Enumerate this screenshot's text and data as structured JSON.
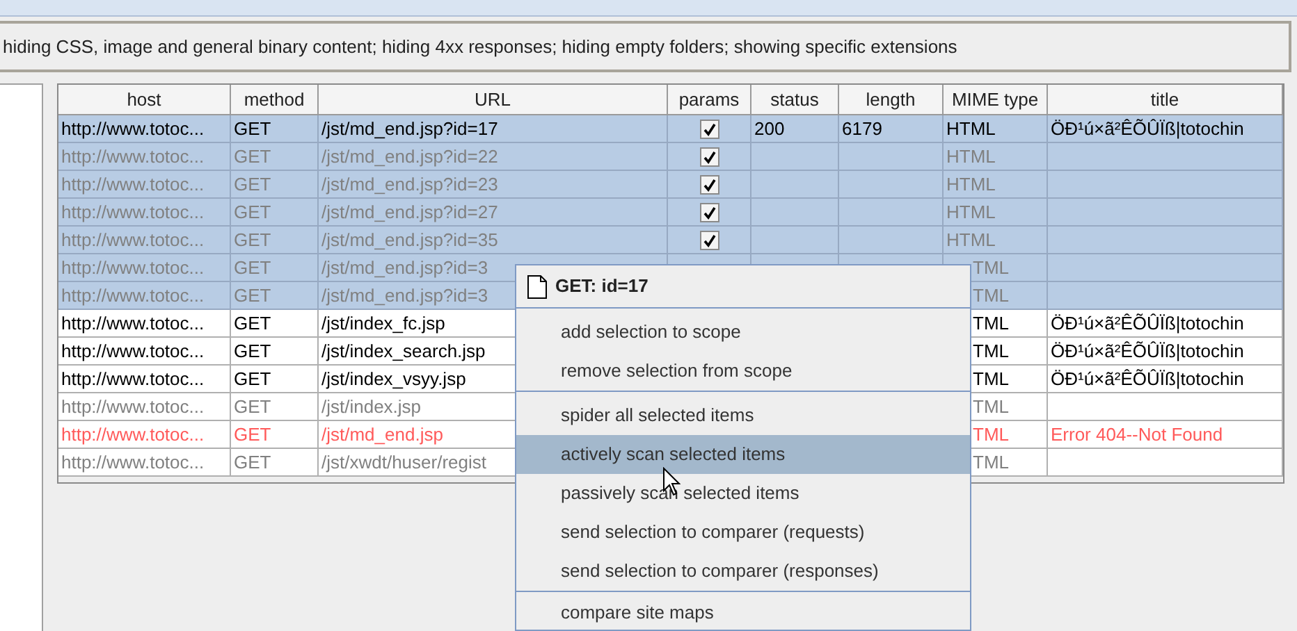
{
  "filter_bar": {
    "text": "hiding CSS, image and general binary content;  hiding 4xx responses;  hiding empty folders;  showing specific extensions"
  },
  "table": {
    "columns": [
      "host",
      "method",
      "URL",
      "params",
      "status",
      "length",
      "MIME type",
      "title"
    ],
    "rows": [
      {
        "host": "http://www.totoc...",
        "method": "GET",
        "url": "/jst/md_end.jsp?id=17",
        "params": {
          "checked": true
        },
        "status": "200",
        "length": "6179",
        "mime": "HTML",
        "title": "ÖÐ¹ú×ã²ÊÕÛÏß|totochin",
        "selected": true,
        "kind": "response"
      },
      {
        "host": "http://www.totoc...",
        "method": "GET",
        "url": "/jst/md_end.jsp?id=22",
        "params": {
          "checked": true
        },
        "mime": "HTML",
        "selected": true,
        "kind": "no_response"
      },
      {
        "host": "http://www.totoc...",
        "method": "GET",
        "url": "/jst/md_end.jsp?id=23",
        "params": {
          "checked": true
        },
        "mime": "HTML",
        "selected": true,
        "kind": "no_response"
      },
      {
        "host": "http://www.totoc...",
        "method": "GET",
        "url": "/jst/md_end.jsp?id=27",
        "params": {
          "checked": true
        },
        "mime": "HTML",
        "selected": true,
        "kind": "no_response"
      },
      {
        "host": "http://www.totoc...",
        "method": "GET",
        "url": "/jst/md_end.jsp?id=35",
        "params": {
          "checked": true
        },
        "mime": "HTML",
        "selected": true,
        "kind": "no_response"
      },
      {
        "host": "http://www.totoc...",
        "method": "GET",
        "url": "/jst/md_end.jsp?id=3",
        "mime": "TML",
        "selected": true,
        "kind": "no_response"
      },
      {
        "host": "http://www.totoc...",
        "method": "GET",
        "url": "/jst/md_end.jsp?id=3",
        "mime": "TML",
        "selected": true,
        "kind": "no_response"
      },
      {
        "host": "http://www.totoc...",
        "method": "GET",
        "url": "/jst/index_fc.jsp",
        "mime": "TML",
        "title": "ÖÐ¹ú×ã²ÊÕÛÏß|totochin",
        "selected": false,
        "kind": "response"
      },
      {
        "host": "http://www.totoc...",
        "method": "GET",
        "url": "/jst/index_search.jsp",
        "mime": "TML",
        "title": "ÖÐ¹ú×ã²ÊÕÛÏß|totochin",
        "selected": false,
        "kind": "response"
      },
      {
        "host": "http://www.totoc...",
        "method": "GET",
        "url": "/jst/index_vsyy.jsp",
        "mime": "TML",
        "title": "ÖÐ¹ú×ã²ÊÕÛÏß|totochin",
        "selected": false,
        "kind": "response"
      },
      {
        "host": "http://www.totoc...",
        "method": "GET",
        "url": "/jst/index.jsp",
        "mime": "TML",
        "selected": false,
        "kind": "no_response"
      },
      {
        "host": "http://www.totoc...",
        "method": "GET",
        "url": "/jst/md_end.jsp",
        "mime": "TML",
        "title": "Error 404--Not Found",
        "selected": false,
        "kind": "error"
      },
      {
        "host": "http://www.totoc...",
        "method": "GET",
        "url": "/jst/xwdt/huser/regist",
        "mime": "TML",
        "selected": false,
        "kind": "no_response"
      }
    ]
  },
  "context_menu": {
    "title": "GET: id=17",
    "sections": [
      [
        {
          "label": "add selection to scope",
          "selected": false
        },
        {
          "label": "remove selection from scope",
          "selected": false
        }
      ],
      [
        {
          "label": "spider all selected items",
          "selected": false
        },
        {
          "label": "actively scan selected items",
          "selected": true
        },
        {
          "label": "passively scan selected items",
          "selected": false
        },
        {
          "label": "send selection to comparer (requests)",
          "selected": false
        },
        {
          "label": "send selection to comparer (responses)",
          "selected": false
        }
      ],
      [
        {
          "label": "compare site maps",
          "selected": false
        }
      ]
    ]
  }
}
